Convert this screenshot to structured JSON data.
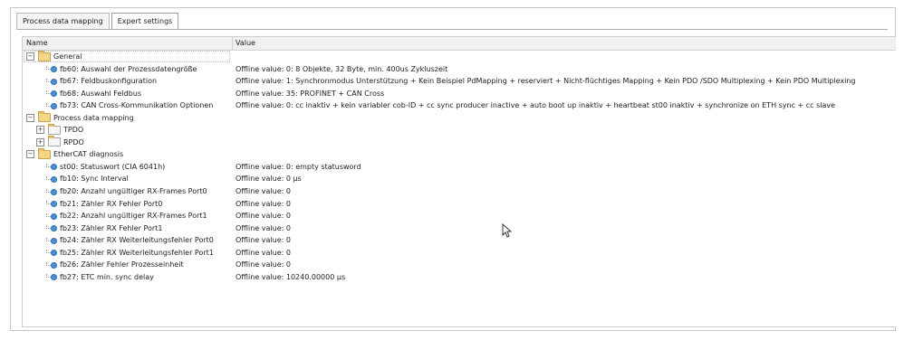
{
  "tabs": [
    "Process data mapping",
    "Expert settings"
  ],
  "columns": {
    "name": "Name",
    "value": "Value"
  },
  "rows": [
    {
      "level": 0,
      "kind": "group",
      "expander": "−",
      "name": "General",
      "value": ""
    },
    {
      "level": 1,
      "kind": "param",
      "name": "fb60: Auswahl der Prozessdatengröße",
      "value": "Offline value: 0: 8 Objekte, 32 Byte, min. 400us Zykluszeit"
    },
    {
      "level": 1,
      "kind": "param",
      "name": "fb67: Feldbuskonfiguration",
      "value": "Offline value: 1: Synchronmodus Unterstützung + Kein Beispiel PdMapping + reserviert + Nicht-flüchtiges Mapping + Kein PDO /SDO Multiplexing + Kein PDO Multiplexing"
    },
    {
      "level": 1,
      "kind": "param",
      "name": "fb68: Auswahl Feldbus",
      "value": "Offline value: 35: PROFINET + CAN Cross"
    },
    {
      "level": 1,
      "kind": "param",
      "name": "fb73: CAN Cross-Kommunikation Optionen",
      "value": "Offline value: 0: cc inaktiv + kein variabler cob-ID + cc sync producer inactive + auto boot up inaktiv + heartbeat st00 inaktiv + synchronize on ETH sync + cc slave"
    },
    {
      "level": 0,
      "kind": "group",
      "expander": "−",
      "name": "Process data mapping",
      "value": ""
    },
    {
      "level": 1,
      "kind": "folder",
      "expander": "+",
      "name": "TPDO",
      "value": ""
    },
    {
      "level": 1,
      "kind": "folder",
      "expander": "+",
      "name": "RPDO",
      "value": ""
    },
    {
      "level": 0,
      "kind": "group",
      "expander": "−",
      "name": "EtherCAT diagnosis",
      "value": ""
    },
    {
      "level": 1,
      "kind": "param",
      "name": "st00: Statuswort (CIA 6041h)",
      "value": "Offline value: 0: empty statusword"
    },
    {
      "level": 1,
      "kind": "param",
      "name": "fb10: Sync Interval",
      "value": "Offline value: 0 µs"
    },
    {
      "level": 1,
      "kind": "param",
      "name": "fb20: Anzahl ungültiger RX-Frames Port0",
      "value": "Offline value: 0"
    },
    {
      "level": 1,
      "kind": "param",
      "name": "fb21: Zähler RX Fehler Port0",
      "value": "Offline value: 0"
    },
    {
      "level": 1,
      "kind": "param",
      "name": "fb22: Anzahl ungültiger RX-Frames Port1",
      "value": "Offline value: 0"
    },
    {
      "level": 1,
      "kind": "param",
      "name": "fb23: Zähler RX Fehler Port1",
      "value": "Offline value: 0"
    },
    {
      "level": 1,
      "kind": "param",
      "name": "fb24: Zähler RX Weiterleitungsfehler Port0",
      "value": "Offline value: 0"
    },
    {
      "level": 1,
      "kind": "param",
      "name": "fb25: Zähler RX Weiterleitungsfehler Port1",
      "value": "Offline value: 0"
    },
    {
      "level": 1,
      "kind": "param",
      "name": "fb26: Zähler Fehler Prozesseinheit",
      "value": "Offline value: 0"
    },
    {
      "level": 1,
      "kind": "param",
      "name": "fb27: ETC min. sync delay",
      "value": "Offline value: 10240.00000 µs"
    }
  ]
}
